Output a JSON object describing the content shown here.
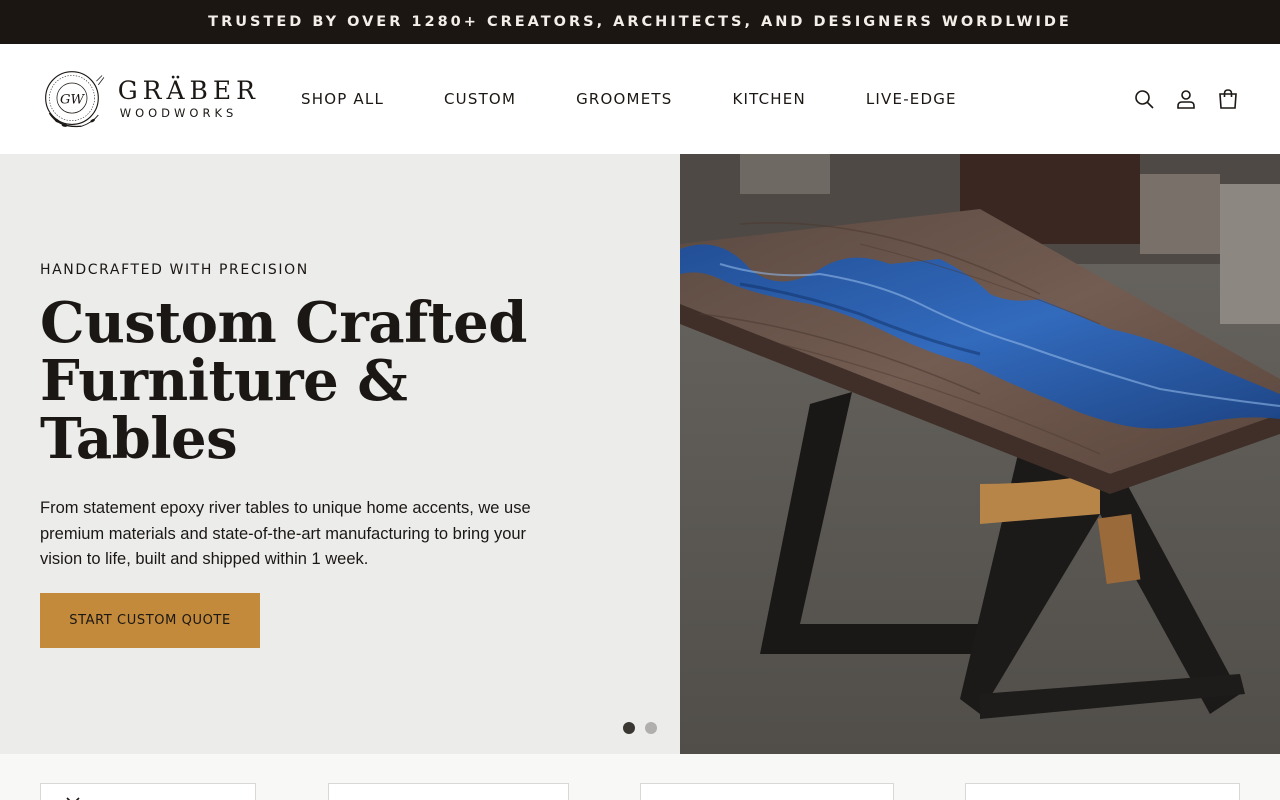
{
  "announcement": {
    "text": "TRUSTED BY OVER 1280+ CREATORS, ARCHITECTS, AND DESIGNERS WORDLWIDE"
  },
  "brand": {
    "line1": "GRÄBER",
    "line2": "WOODWORKS",
    "monogram": "GW"
  },
  "nav": {
    "items": [
      {
        "label": "SHOP ALL"
      },
      {
        "label": "CUSTOM"
      },
      {
        "label": "GROOMETS"
      },
      {
        "label": "KITCHEN"
      },
      {
        "label": "LIVE-EDGE"
      }
    ]
  },
  "header_icons": [
    "search-icon",
    "account-icon",
    "cart-icon"
  ],
  "hero": {
    "kicker": "HANDCRAFTED WITH PRECISION",
    "title_line1": "Custom Crafted",
    "title_line2": "Furniture &",
    "title_line3": "Tables",
    "body": "From statement epoxy river tables to unique home accents, we use premium materials and state-of-the-art manufacturing to bring your vision to life, built and shipped within 1 week.",
    "cta_label": "START CUSTOM QUOTE",
    "slides_total": 2,
    "active_slide": 1,
    "image": "epoxy-river-table-photo"
  },
  "colors": {
    "announcement_bg": "#1b1612",
    "hero_left_bg": "#ececea",
    "cta_bg": "#c28a3a",
    "text": "#1b1714"
  }
}
